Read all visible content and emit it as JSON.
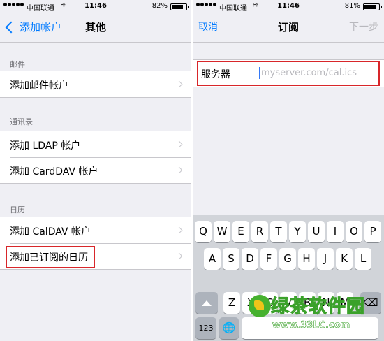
{
  "left": {
    "status": {
      "carrier": "中国联通",
      "time": "11:46",
      "battery": "82%",
      "battery_level": 0.82
    },
    "nav": {
      "back_label": "添加帐户",
      "title": "其他"
    },
    "sections": [
      {
        "header": "邮件",
        "items": [
          {
            "label": "添加邮件帐户"
          }
        ]
      },
      {
        "header": "通讯录",
        "items": [
          {
            "label": "添加 LDAP 帐户"
          },
          {
            "label": "添加 CardDAV 帐户"
          }
        ]
      },
      {
        "header": "日历",
        "items": [
          {
            "label": "添加 CalDAV 帐户"
          },
          {
            "label": "添加已订阅的日历"
          }
        ]
      }
    ]
  },
  "right": {
    "status": {
      "carrier": "中国联通",
      "time": "11:46",
      "battery": "81%",
      "battery_level": 0.81
    },
    "nav": {
      "cancel_label": "取消",
      "title": "订阅",
      "next_label": "下一步"
    },
    "server": {
      "label": "服务器",
      "placeholder": "myserver.com/cal.ics",
      "value": ""
    },
    "keyboard": {
      "row1": [
        "Q",
        "W",
        "E",
        "R",
        "T",
        "Y",
        "U",
        "I",
        "O",
        "P"
      ],
      "row2": [
        "A",
        "S",
        "D",
        "F",
        "G",
        "H",
        "J",
        "K",
        "L"
      ],
      "row3": [
        "Z",
        "X",
        "C",
        "V",
        "B",
        "N",
        "M"
      ],
      "numbers_label": "123",
      "globe_label": "🌐"
    }
  },
  "watermark": {
    "text": "绿茶软件园",
    "url": "www.33LC.com"
  },
  "colors": {
    "accent": "#007aff",
    "highlight": "#d8262a",
    "background": "#efeff4"
  }
}
